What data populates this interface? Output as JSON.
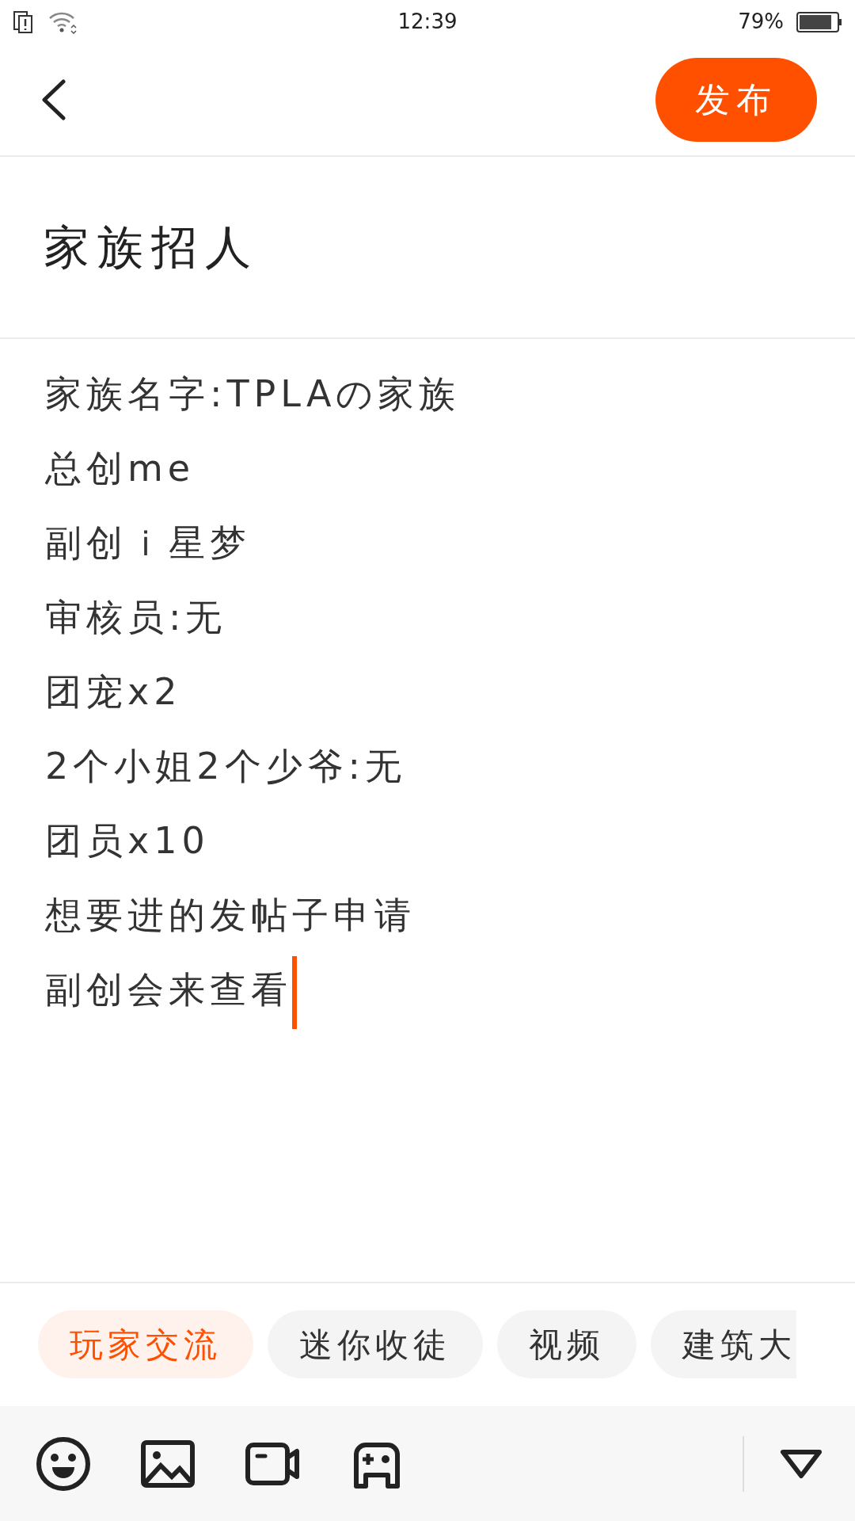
{
  "status_bar": {
    "time": "12:39",
    "battery": "79%"
  },
  "header": {
    "publish_button": "发布"
  },
  "title": "家族招人",
  "body": {
    "lines": [
      "家族名字:TPLAの家族",
      "总创me",
      "副创ｉ星梦",
      "审核员:无",
      "团宠x2",
      "2个小姐2个少爷:无",
      "团员x10",
      "想要进的发帖子申请",
      "副创会来查看"
    ],
    "caret": true
  },
  "topics": [
    {
      "label": "玩家交流",
      "selected": true
    },
    {
      "label": "迷你收徒",
      "selected": false
    },
    {
      "label": "视频",
      "selected": false
    },
    {
      "label": "建筑大",
      "selected": false
    }
  ]
}
